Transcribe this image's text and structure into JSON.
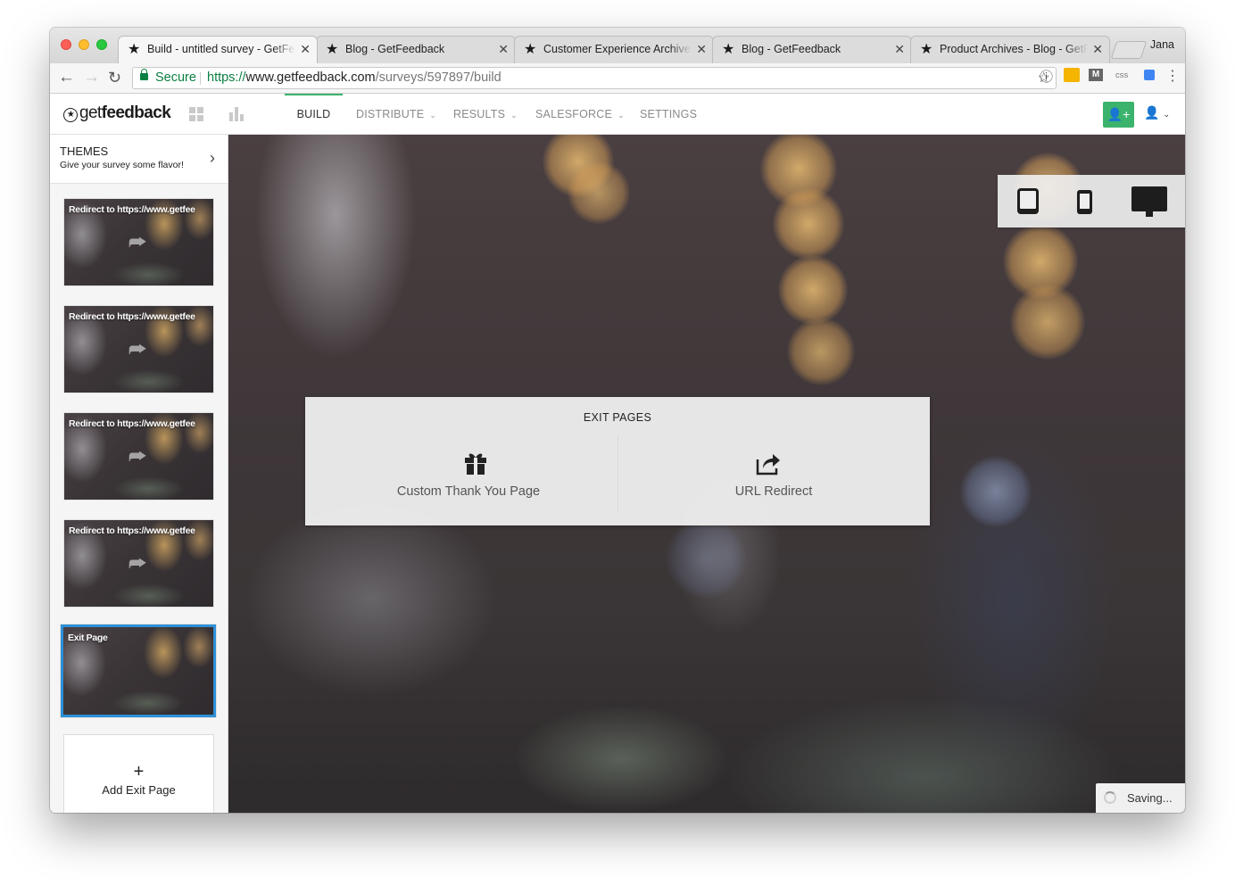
{
  "browser": {
    "tabs": [
      {
        "title": "Build - untitled survey - GetFeedback",
        "active": true
      },
      {
        "title": "Blog - GetFeedback",
        "active": false
      },
      {
        "title": "Customer Experience Archives",
        "active": false
      },
      {
        "title": "Blog - GetFeedback",
        "active": false
      },
      {
        "title": "Product Archives - Blog - GetFeedback",
        "active": false
      }
    ],
    "profile_name": "Jana",
    "secure_label": "Secure",
    "url": {
      "scheme": "https://",
      "host": "www.getfeedback.com",
      "path": "/surveys/597897/build"
    },
    "extension_css_label": "css"
  },
  "app": {
    "logo_prefix": "get",
    "logo_bold": "feedback",
    "nav": {
      "build": "BUILD",
      "distribute": "DISTRIBUTE",
      "results": "RESULTS",
      "salesforce": "SALESFORCE",
      "settings": "SETTINGS"
    }
  },
  "sidebar": {
    "themes_title": "THEMES",
    "themes_subtitle": "Give your survey some flavor!",
    "pages": [
      {
        "label": "Redirect to https://www.getfee"
      },
      {
        "label": "Redirect to https://www.getfee"
      },
      {
        "label": "Redirect to https://www.getfee"
      },
      {
        "label": "Redirect to https://www.getfee"
      },
      {
        "label": "Exit Page",
        "selected": true
      }
    ],
    "add_exit_plus": "+",
    "add_exit_label": "Add Exit Page"
  },
  "canvas": {
    "exit_pages_title": "EXIT PAGES",
    "options": {
      "thank_you": "Custom Thank You Page",
      "url_redirect": "URL Redirect"
    },
    "saving_text": "Saving..."
  },
  "colors": {
    "accent_green": "#3bb36d",
    "selected_blue": "#2d8fd6",
    "secure_green": "#0b8043"
  }
}
